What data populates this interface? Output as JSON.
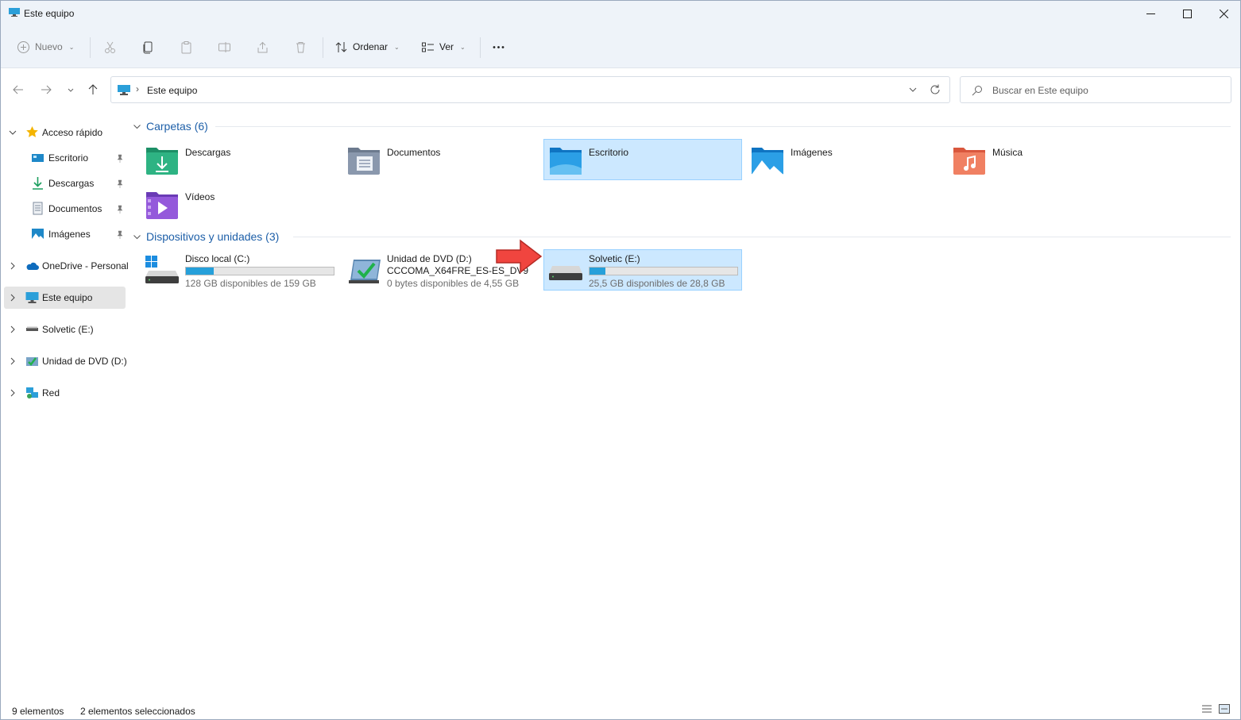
{
  "window": {
    "title": "Este equipo",
    "accent": "#0067c0"
  },
  "toolbar": {
    "new_label": "Nuevo",
    "sort_label": "Ordenar",
    "view_label": "Ver"
  },
  "address": {
    "path": "Este equipo"
  },
  "search": {
    "placeholder": "Buscar en Este equipo"
  },
  "sidebar": {
    "items": [
      {
        "label": "Acceso rápido",
        "icon": "star-icon"
      },
      {
        "label": "Escritorio",
        "icon": "desktop-icon",
        "pinned": true
      },
      {
        "label": "Descargas",
        "icon": "download-icon",
        "pinned": true
      },
      {
        "label": "Documentos",
        "icon": "document-icon",
        "pinned": true
      },
      {
        "label": "Imágenes",
        "icon": "pictures-icon",
        "pinned": true
      },
      {
        "label": "OneDrive - Personal",
        "icon": "cloud-icon"
      },
      {
        "label": "Este equipo",
        "icon": "computer-icon",
        "selected": true
      },
      {
        "label": "Solvetic (E:)",
        "icon": "usb-drive-icon"
      },
      {
        "label": "Unidad de DVD (D:)",
        "icon": "dvd-drive-icon"
      },
      {
        "label": "Red",
        "icon": "network-icon"
      }
    ]
  },
  "content": {
    "folders_header": "Carpetas (6)",
    "folders": [
      {
        "name": "Descargas",
        "icon": "downloads-folder-icon"
      },
      {
        "name": "Documentos",
        "icon": "documents-folder-icon"
      },
      {
        "name": "Escritorio",
        "icon": "desktop-folder-icon",
        "selected": true
      },
      {
        "name": "Imágenes",
        "icon": "pictures-folder-icon"
      },
      {
        "name": "Música",
        "icon": "music-folder-icon"
      },
      {
        "name": "Vídeos",
        "icon": "videos-folder-icon"
      }
    ],
    "devices_header": "Dispositivos y unidades (3)",
    "devices": [
      {
        "name": "Disco local (C:)",
        "free": "128 GB disponibles de 159 GB",
        "used_fraction": 0.19
      },
      {
        "name": "Unidad de DVD (D:)",
        "label": "CCCOMA_X64FRE_ES-ES_DV9",
        "free": "0 bytes disponibles de 4,55 GB"
      },
      {
        "name": "Solvetic (E:)",
        "free": "25,5 GB disponibles de 28,8 GB",
        "used_fraction": 0.11,
        "selected": true
      }
    ]
  },
  "status": {
    "count": "9 elementos",
    "selection": "2 elementos seleccionados"
  }
}
